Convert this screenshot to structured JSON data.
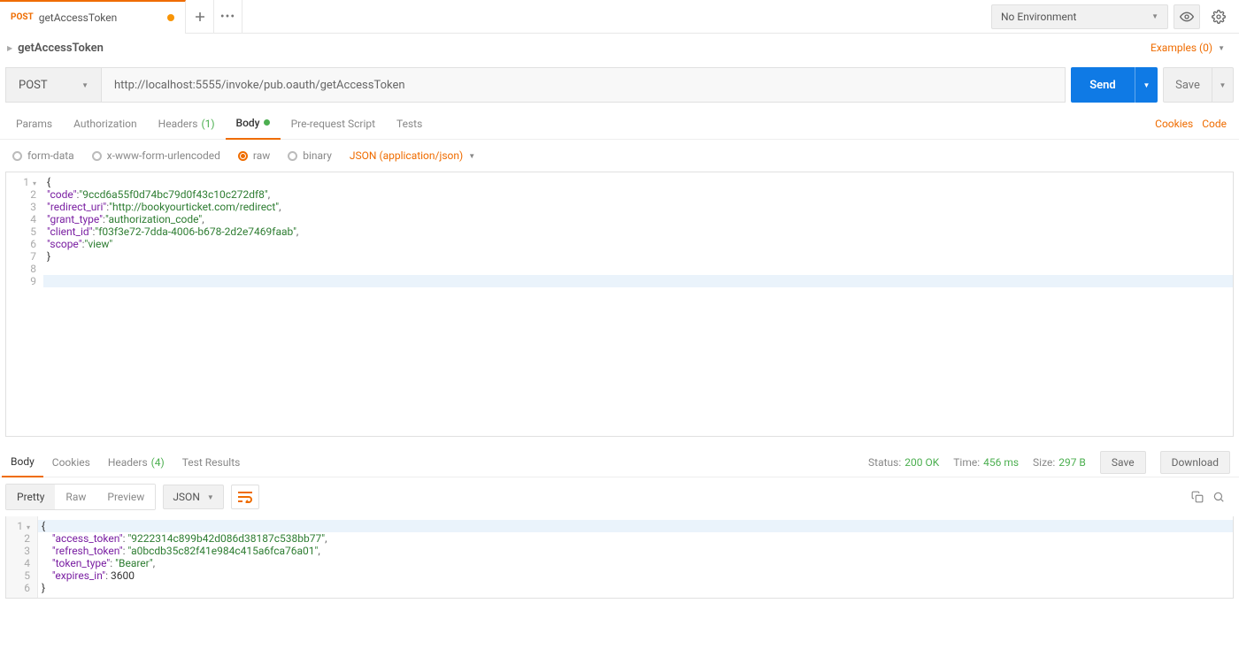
{
  "topbar": {
    "tab": {
      "method": "POST",
      "title": "getAccessToken"
    },
    "env_label": "No Environment"
  },
  "breadcrumb": {
    "name": "getAccessToken",
    "examples_label": "Examples (0)"
  },
  "request": {
    "method": "POST",
    "url": "http://localhost:5555/invoke/pub.oauth/getAccessToken",
    "send_label": "Send",
    "save_label": "Save"
  },
  "req_tabs": {
    "params": "Params",
    "auth": "Authorization",
    "headers": "Headers",
    "headers_count": "(1)",
    "body": "Body",
    "prereq": "Pre-request Script",
    "tests": "Tests",
    "cookies": "Cookies",
    "code": "Code"
  },
  "body_types": {
    "formdata": "form-data",
    "urlenc": "x-www-form-urlencoded",
    "raw": "raw",
    "binary": "binary",
    "content_type": "JSON (application/json)"
  },
  "req_body_json": {
    "code": "9ccd6a55f0d74bc79d0f43c10c272df8",
    "redirect_uri": "http://bookyourticket.com/redirect",
    "grant_type": "authorization_code",
    "client_id": "f03f3e72-7dda-4006-b678-2d2e7469faab",
    "scope": "view"
  },
  "resp_tabs": {
    "body": "Body",
    "cookies": "Cookies",
    "headers": "Headers",
    "headers_count": "(4)",
    "tests": "Test Results"
  },
  "resp_status": {
    "status_label": "Status:",
    "status_value": "200 OK",
    "time_label": "Time:",
    "time_value": "456 ms",
    "size_label": "Size:",
    "size_value": "297 B",
    "save_label": "Save",
    "download_label": "Download"
  },
  "resp_viewmode": {
    "pretty": "Pretty",
    "raw": "Raw",
    "preview": "Preview",
    "lang": "JSON"
  },
  "resp_body_json": {
    "access_token": "9222314c899b42d086d38187c538bb77",
    "refresh_token": "a0bcdb35c82f41e984c415a6fca76a01",
    "token_type": "Bearer",
    "expires_in": 3600
  }
}
